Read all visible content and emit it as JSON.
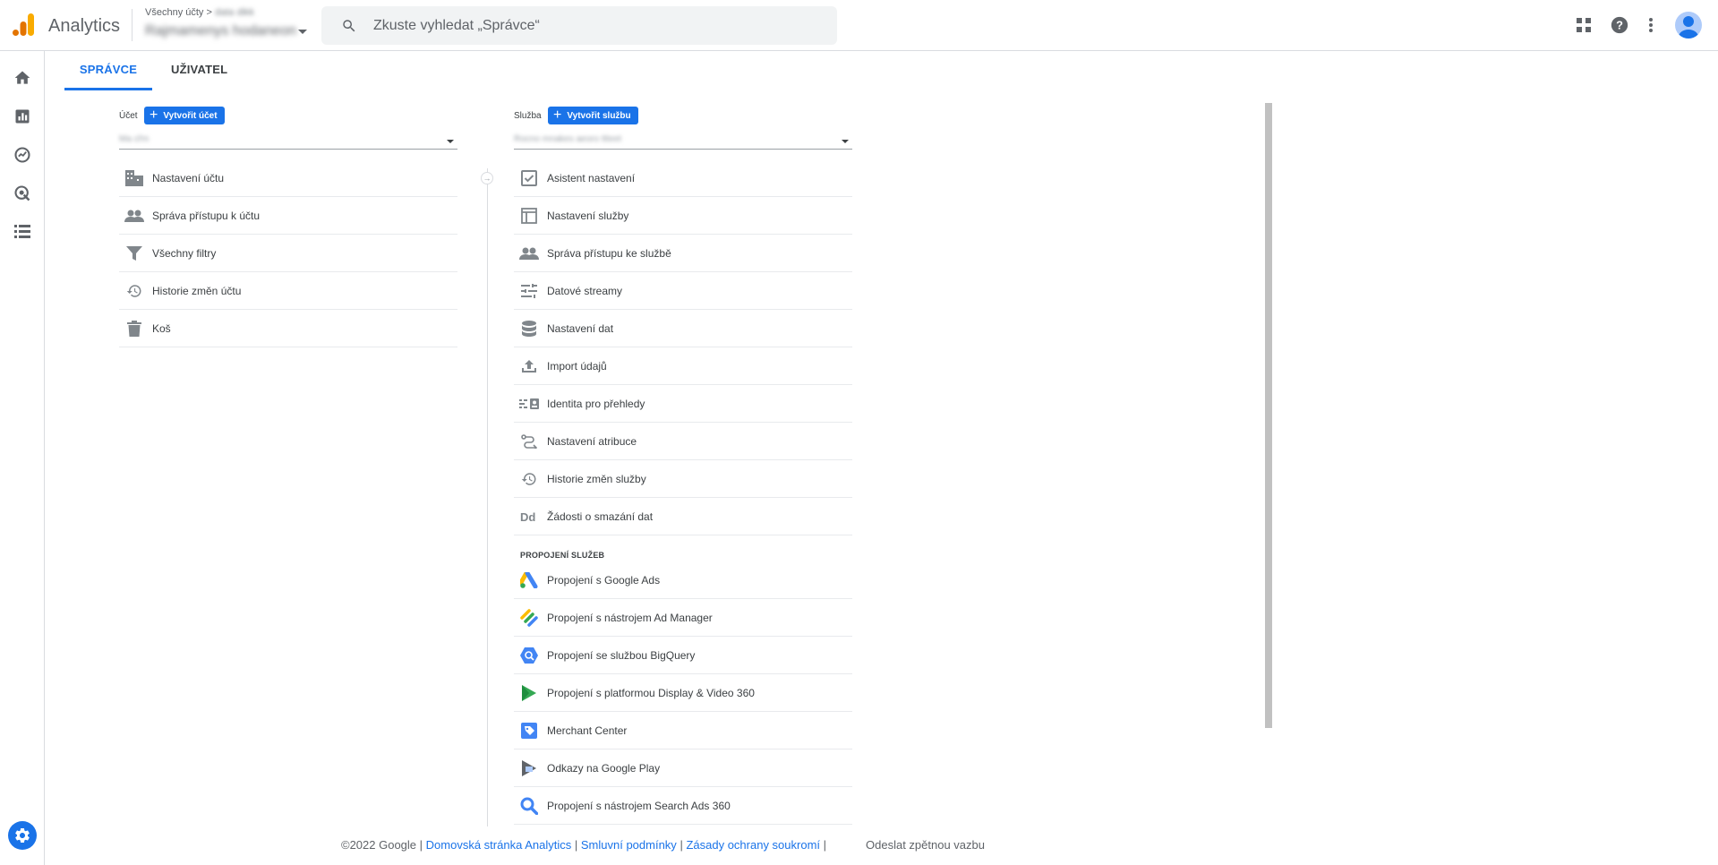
{
  "header": {
    "app_title": "Analytics",
    "breadcrumb_root": "Všechny účty",
    "breadcrumb_sep": ">",
    "breadcrumb_account": "data dikk",
    "property_name": "Rajmamenys hodaneon",
    "search_placeholder": "Zkuste vyhledat „Správce“"
  },
  "tabs": [
    {
      "label": "SPRÁVCE",
      "active": true
    },
    {
      "label": "UŽIVATEL",
      "active": false
    }
  ],
  "account_column": {
    "label": "Účet",
    "create_button": "Vytvořit účet",
    "selected_value": "Ma cřm",
    "items": [
      {
        "label": "Nastavení účtu",
        "icon": "building-icon"
      },
      {
        "label": "Správa přístupu k účtu",
        "icon": "people-icon"
      },
      {
        "label": "Všechny filtry",
        "icon": "filter-icon"
      },
      {
        "label": "Historie změn účtu",
        "icon": "history-icon"
      },
      {
        "label": "Koš",
        "icon": "trash-icon"
      }
    ]
  },
  "property_column": {
    "label": "Služba",
    "create_button": "Vytvořit službu",
    "selected_value": "Rocno mnakes aeoro ttteet",
    "items": [
      {
        "label": "Asistent nastavení",
        "icon": "checkbox-icon"
      },
      {
        "label": "Nastavení služby",
        "icon": "layout-icon"
      },
      {
        "label": "Správa přístupu ke službě",
        "icon": "people-icon"
      },
      {
        "label": "Datové streamy",
        "icon": "streams-icon"
      },
      {
        "label": "Nastavení dat",
        "icon": "database-icon"
      },
      {
        "label": "Import údajů",
        "icon": "upload-icon"
      },
      {
        "label": "Identita pro přehledy",
        "icon": "identity-icon"
      },
      {
        "label": "Nastavení atribuce",
        "icon": "attribution-icon"
      },
      {
        "label": "Historie změn služby",
        "icon": "history-icon"
      },
      {
        "label": "Žádosti o smazání dat",
        "icon": "dd-icon"
      }
    ],
    "links_section_title": "PROPOJENÍ SLUŽEB",
    "links": [
      {
        "label": "Propojení s Google Ads",
        "icon": "google-ads-icon"
      },
      {
        "label": "Propojení s nástrojem Ad Manager",
        "icon": "ad-manager-icon"
      },
      {
        "label": "Propojení se službou BigQuery",
        "icon": "bigquery-icon"
      },
      {
        "label": "Propojení s platformou Display & Video 360",
        "icon": "dv360-icon"
      },
      {
        "label": "Merchant Center",
        "icon": "merchant-center-icon"
      },
      {
        "label": "Odkazy na Google Play",
        "icon": "google-play-icon"
      },
      {
        "label": "Propojení s nástrojem Search Ads 360",
        "icon": "search-ads-icon"
      }
    ]
  },
  "footer": {
    "copyright": "©2022 Google |",
    "link_home": "Domovská stránka Analytics",
    "sep1": "|",
    "link_terms": "Smluvní podmínky",
    "sep2": "|",
    "link_privacy": "Zásady ochrany soukromí",
    "sep3": "|",
    "feedback": "Odeslat zpětnou vazbu"
  },
  "colors": {
    "accent": "#1a73e8",
    "logo_orange": "#f9ab00",
    "logo_dark_orange": "#e37400"
  }
}
